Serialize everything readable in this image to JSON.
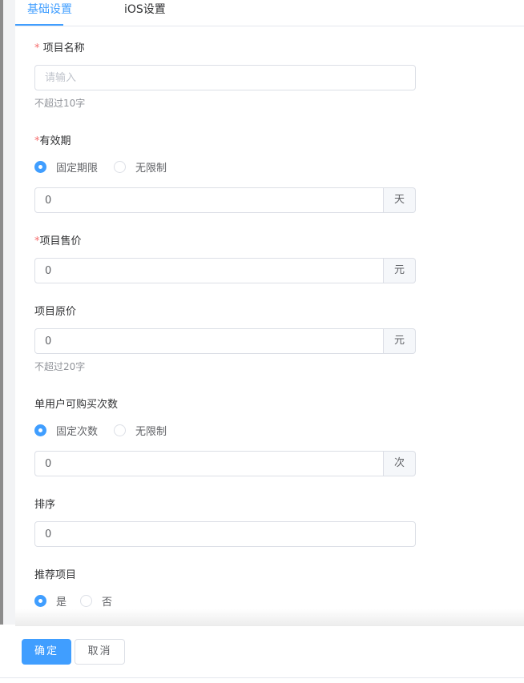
{
  "tabs": {
    "basic": "基础设置",
    "ios": "iOS设置"
  },
  "form": {
    "name": {
      "required_mark": "*",
      "label": " 项目名称",
      "placeholder": "请输入",
      "hint": "不超过10字"
    },
    "validity": {
      "required_mark": "*",
      "label": "有效期",
      "options": [
        "固定期限",
        "无限制"
      ],
      "selected": "固定期限",
      "value": "0",
      "unit": "天"
    },
    "sale_price": {
      "required_mark": "*",
      "label": "项目售价",
      "value": "0",
      "unit": "元"
    },
    "original_price": {
      "label": "项目原价",
      "value": "0",
      "unit": "元",
      "hint": "不超过20字"
    },
    "purchase_limit": {
      "label": "单用户可购买次数",
      "options": [
        "固定次数",
        "无限制"
      ],
      "selected": "固定次数",
      "value": "0",
      "unit": "次"
    },
    "sort": {
      "label": "排序",
      "value": "0"
    },
    "recommend": {
      "label": "推荐项目",
      "options": [
        "是",
        "否"
      ],
      "selected": "是"
    }
  },
  "footer": {
    "confirm": "确定",
    "cancel": "取消"
  },
  "colors": {
    "accent": "#409eff",
    "required": "#f56c6c"
  }
}
